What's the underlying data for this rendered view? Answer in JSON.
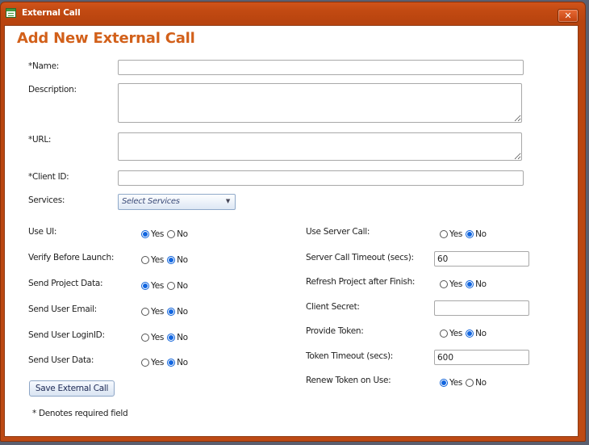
{
  "window": {
    "title": "External Call",
    "close_label": "✕"
  },
  "page_title": "Add New External Call",
  "fields": {
    "name": {
      "label": "*Name:",
      "value": ""
    },
    "description": {
      "label": "Description:",
      "value": ""
    },
    "url": {
      "label": "*URL:",
      "value": ""
    },
    "client_id": {
      "label": "*Client ID:",
      "value": ""
    },
    "services": {
      "label": "Services:",
      "placeholder": "Select Services"
    }
  },
  "radio_labels": {
    "yes": "Yes",
    "no": "No"
  },
  "left_options": [
    {
      "label": "Use UI:",
      "selected": "yes"
    },
    {
      "label": "Verify Before Launch:",
      "selected": "no"
    },
    {
      "label": "Send Project Data:",
      "selected": "yes"
    },
    {
      "label": "Send User Email:",
      "selected": "no"
    },
    {
      "label": "Send User LoginID:",
      "selected": "no"
    },
    {
      "label": "Send User Data:",
      "selected": "no"
    }
  ],
  "right_options": {
    "use_server_call": {
      "label": "Use Server Call:",
      "selected": "no"
    },
    "server_call_timeout": {
      "label": "Server Call Timeout (secs):",
      "value": "60"
    },
    "refresh_project": {
      "label": "Refresh Project after Finish:",
      "selected": "no"
    },
    "client_secret": {
      "label": "Client Secret:",
      "value": ""
    },
    "provide_token": {
      "label": "Provide Token:",
      "selected": "no"
    },
    "token_timeout": {
      "label": "Token Timeout (secs):",
      "value": "600"
    },
    "renew_token": {
      "label": "Renew Token on Use:",
      "selected": "yes"
    }
  },
  "save_button": "Save External Call",
  "required_note": "* Denotes required field"
}
